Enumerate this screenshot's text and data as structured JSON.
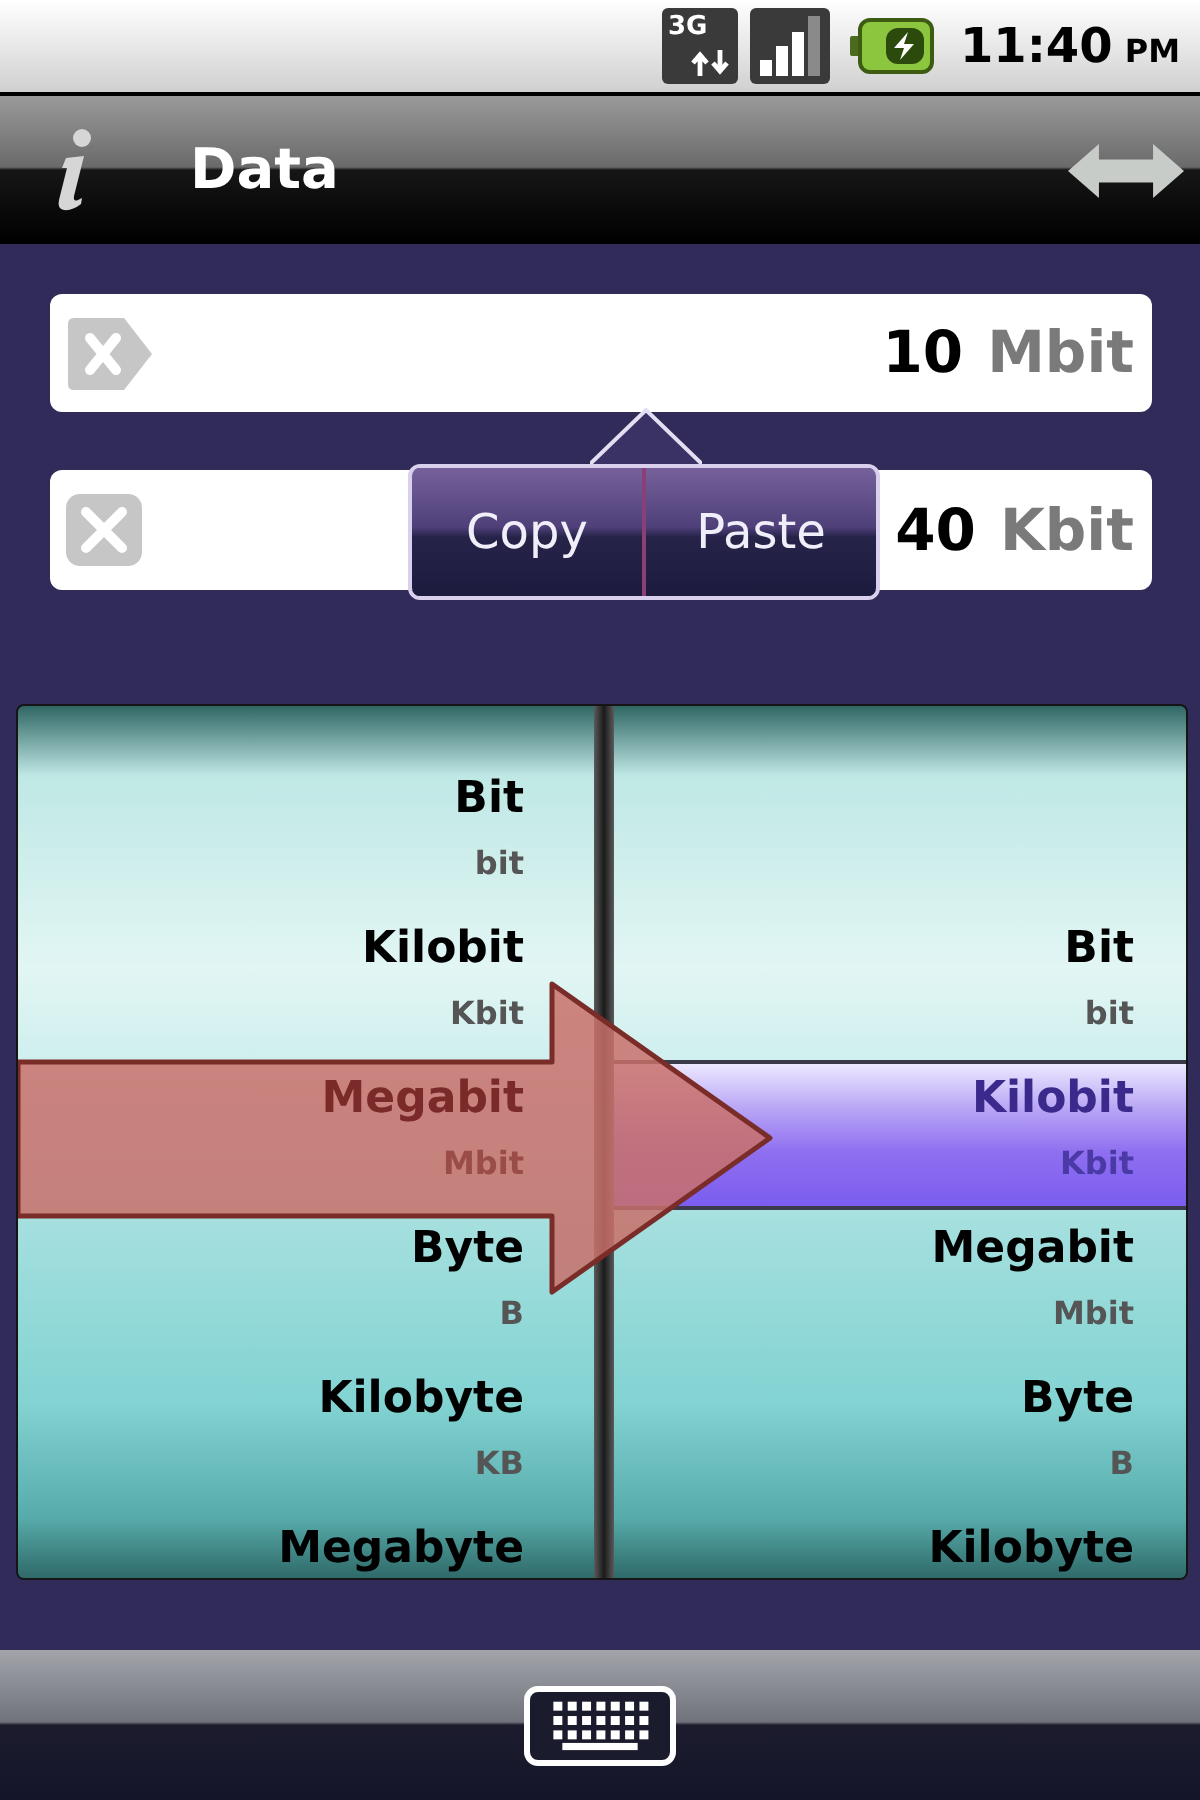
{
  "status_bar": {
    "network": "3G",
    "time": "11:40",
    "period": "PM"
  },
  "title_bar": {
    "title": "Data"
  },
  "fields": [
    {
      "kind": "source",
      "value": "10",
      "unit": "Mbit"
    },
    {
      "kind": "result",
      "value": "40",
      "unit": "Kbit"
    }
  ],
  "popup_menu": [
    "Copy",
    "Paste"
  ],
  "from_units": [
    {
      "name": "Bit",
      "symbol": "bit",
      "selected": false
    },
    {
      "name": "Kilobit",
      "symbol": "Kbit",
      "selected": false
    },
    {
      "name": "Megabit",
      "symbol": "Mbit",
      "selected": true
    },
    {
      "name": "Byte",
      "symbol": "B",
      "selected": false
    },
    {
      "name": "Kilobyte",
      "symbol": "KB",
      "selected": false
    },
    {
      "name": "Megabyte",
      "selected": false
    }
  ],
  "to_units": [
    {
      "name": "Bit",
      "symbol": "bit",
      "selected": false
    },
    {
      "name": "Kilobit",
      "symbol": "Kbit",
      "selected": true
    },
    {
      "name": "Megabit",
      "symbol": "Mbit",
      "selected": false
    },
    {
      "name": "Byte",
      "symbol": "B",
      "selected": false
    },
    {
      "name": "Kilobyte",
      "selected": false
    }
  ]
}
